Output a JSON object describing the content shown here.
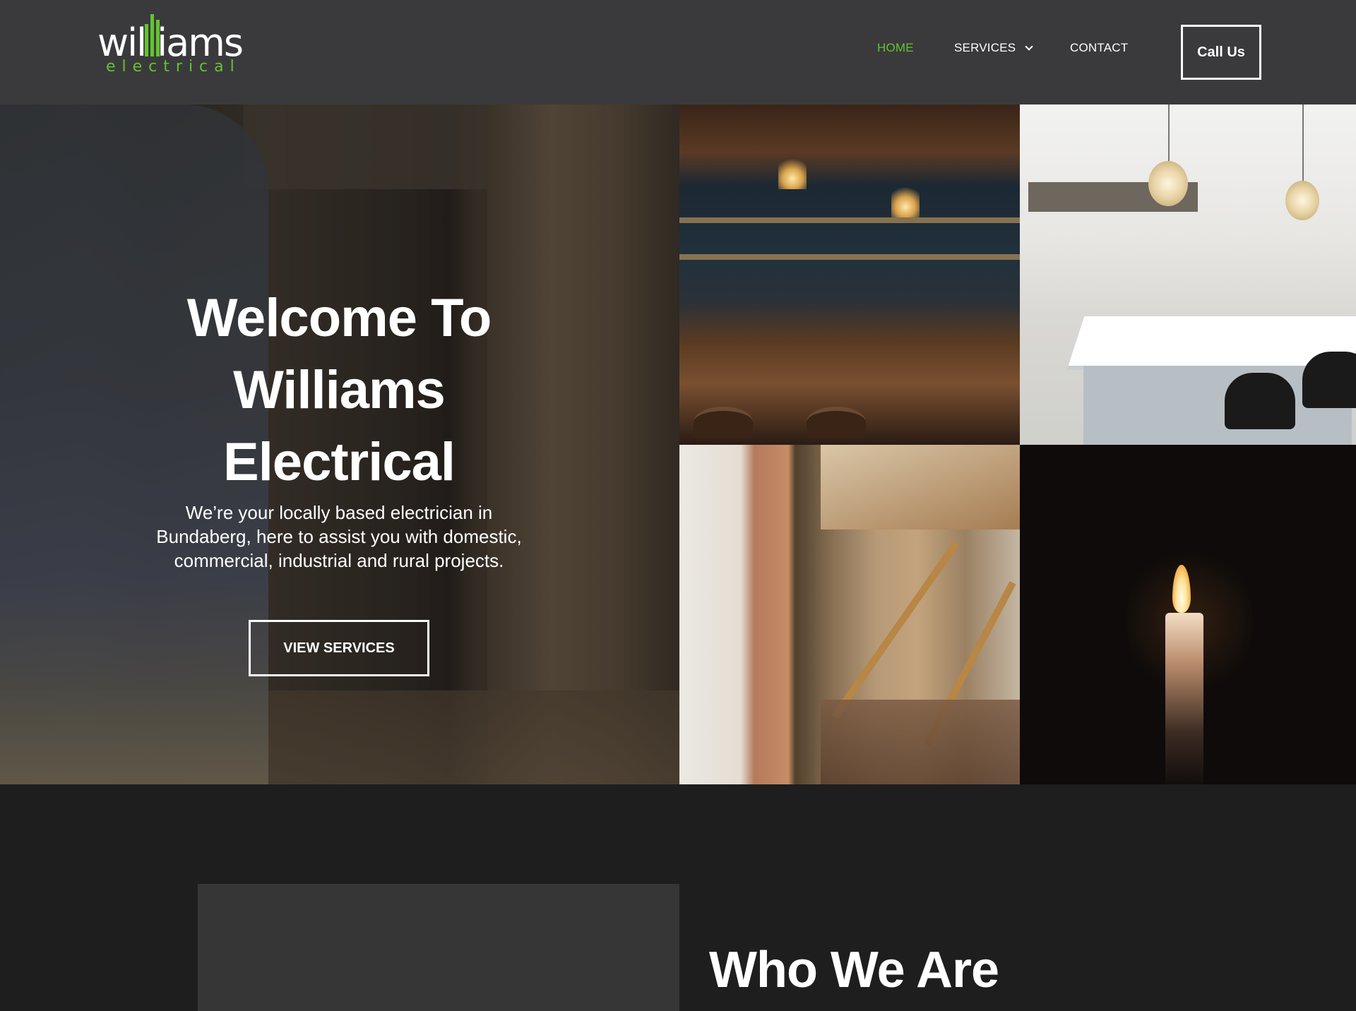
{
  "brand": {
    "logo_main_prefix": "wil",
    "logo_main_suffix": "iams",
    "logo_sub": "electrical",
    "accent_color": "#62c42e"
  },
  "nav": {
    "items": [
      {
        "label": "HOME",
        "active": true
      },
      {
        "label": "SERVICES",
        "has_dropdown": true,
        "icon": "chevron-down-icon"
      },
      {
        "label": "CONTACT"
      }
    ],
    "cta_label": "Call Us"
  },
  "hero": {
    "title_lines": [
      "Welcome To",
      "Williams",
      "Electrical"
    ],
    "text": "We’re your locally based electrician in Bundaberg, here to assist you with domestic, commercial, industrial and rural projects.",
    "button_label": "VIEW SERVICES"
  },
  "gallery": [
    {
      "name": "bar-photo"
    },
    {
      "name": "kitchen-photo"
    },
    {
      "name": "renovation-photo"
    },
    {
      "name": "candle-photo"
    }
  ],
  "about": {
    "title": "Who We Are"
  }
}
